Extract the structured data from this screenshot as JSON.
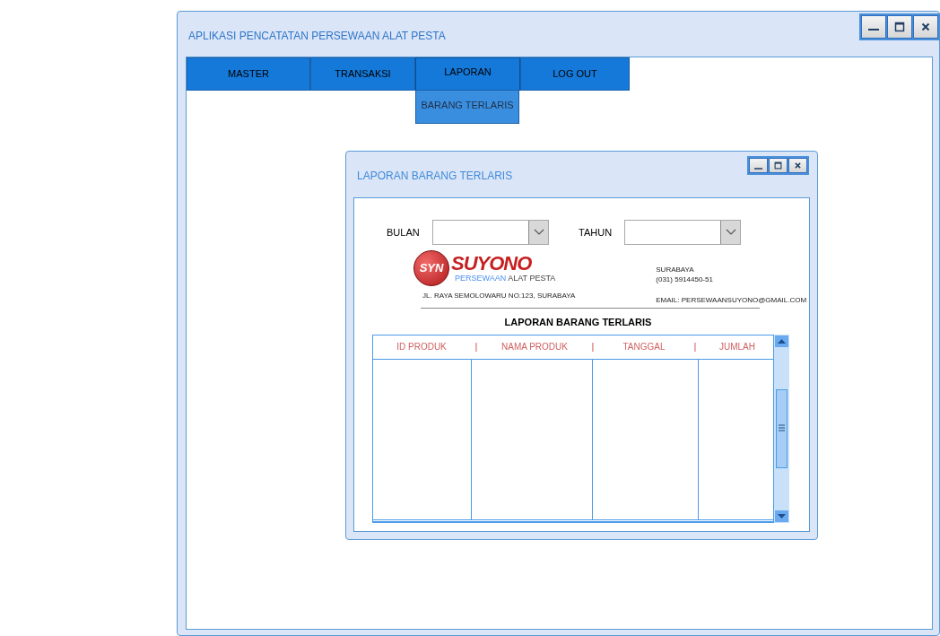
{
  "window": {
    "title": "APLIKASI PENCATATAN PERSEWAAN ALAT PESTA"
  },
  "menu": [
    {
      "label": "MASTER",
      "expanded": false
    },
    {
      "label": "TRANSAKSI",
      "expanded": false
    },
    {
      "label": "LAPORAN",
      "expanded": true,
      "children": [
        {
          "label": "BARANG TERLARIS"
        }
      ]
    },
    {
      "label": "LOG OUT",
      "expanded": false
    }
  ],
  "dialog": {
    "title": "LAPORAN BARANG TERLARIS",
    "filters": [
      {
        "label": "BULAN"
      },
      {
        "label": "TAHUN"
      }
    ],
    "report": {
      "logo": {
        "badge": "SYN",
        "name": "SUYONO",
        "tagline_highlight": "PERSEWAAN",
        "tagline_rest": "ALAT PESTA"
      },
      "address": "JL. RAYA SEMOLOWARU NO.123, SURABAYA",
      "city": "SURABAYA",
      "phone": "(031) 5914450-51",
      "email": "EMAIL: PERSEWAANSUYONO@GMAIL.COM",
      "title": "LAPORAN BARANG TERLARIS"
    },
    "table": {
      "header": [
        {
          "kind": "label",
          "text": "ID PRODUK"
        },
        {
          "kind": "separator",
          "text": "|"
        },
        {
          "kind": "label",
          "text": "NAMA PRODUK"
        },
        {
          "kind": "separator",
          "text": "|"
        },
        {
          "kind": "label",
          "text": "TANGGAL"
        },
        {
          "kind": "separator",
          "text": "|"
        },
        {
          "kind": "label",
          "text": "JUMLAH"
        }
      ]
    }
  }
}
